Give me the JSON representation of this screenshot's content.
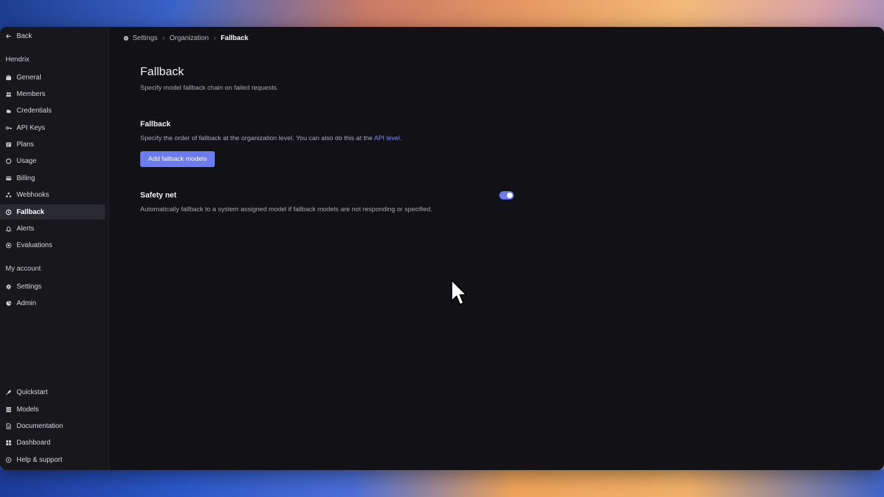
{
  "sidebar": {
    "back_label": "Back",
    "org_heading": "Hendrix",
    "org_items": [
      {
        "label": "General",
        "icon": "briefcase-icon"
      },
      {
        "label": "Members",
        "icon": "users-icon"
      },
      {
        "label": "Credentials",
        "icon": "cloud-icon"
      },
      {
        "label": "API Keys",
        "icon": "key-icon"
      },
      {
        "label": "Plans",
        "icon": "plan-icon"
      },
      {
        "label": "Usage",
        "icon": "circle-icon"
      },
      {
        "label": "Billing",
        "icon": "card-icon"
      },
      {
        "label": "Webhooks",
        "icon": "webhook-icon"
      },
      {
        "label": "Fallback",
        "icon": "clock-icon"
      },
      {
        "label": "Alerts",
        "icon": "bell-icon"
      },
      {
        "label": "Evaluations",
        "icon": "target-icon"
      }
    ],
    "account_heading": "My account",
    "account_items": [
      {
        "label": "Settings",
        "icon": "gear-icon"
      },
      {
        "label": "Admin",
        "icon": "pie-icon"
      }
    ],
    "bottom_items": [
      {
        "label": "Quickstart",
        "icon": "rocket-icon"
      },
      {
        "label": "Models",
        "icon": "grid-icon"
      },
      {
        "label": "Documentation",
        "icon": "document-icon"
      },
      {
        "label": "Dashboard",
        "icon": "dashboard-icon"
      },
      {
        "label": "Help & support",
        "icon": "help-icon"
      }
    ]
  },
  "breadcrumb": {
    "settings": "Settings",
    "organization": "Organization",
    "current": "Fallback"
  },
  "main": {
    "title": "Fallback",
    "subtitle": "Specify model fallback chain on failed requests.",
    "fallback_section": {
      "title": "Fallback",
      "description_prefix": "Specify the order of fallback at the organization level. You can also do this at the ",
      "link_text": "API level",
      "description_suffix": ".",
      "button_label": "Add fallback models"
    },
    "safety_net": {
      "title": "Safety net",
      "description": "Automatically fallback to a system assigned model if fallback models are not responding or specified.",
      "enabled": true
    }
  },
  "colors": {
    "accent": "#6a7cf0",
    "link": "#7b8cff",
    "window_bg": "#111116",
    "sidebar_bg": "#17171c"
  }
}
